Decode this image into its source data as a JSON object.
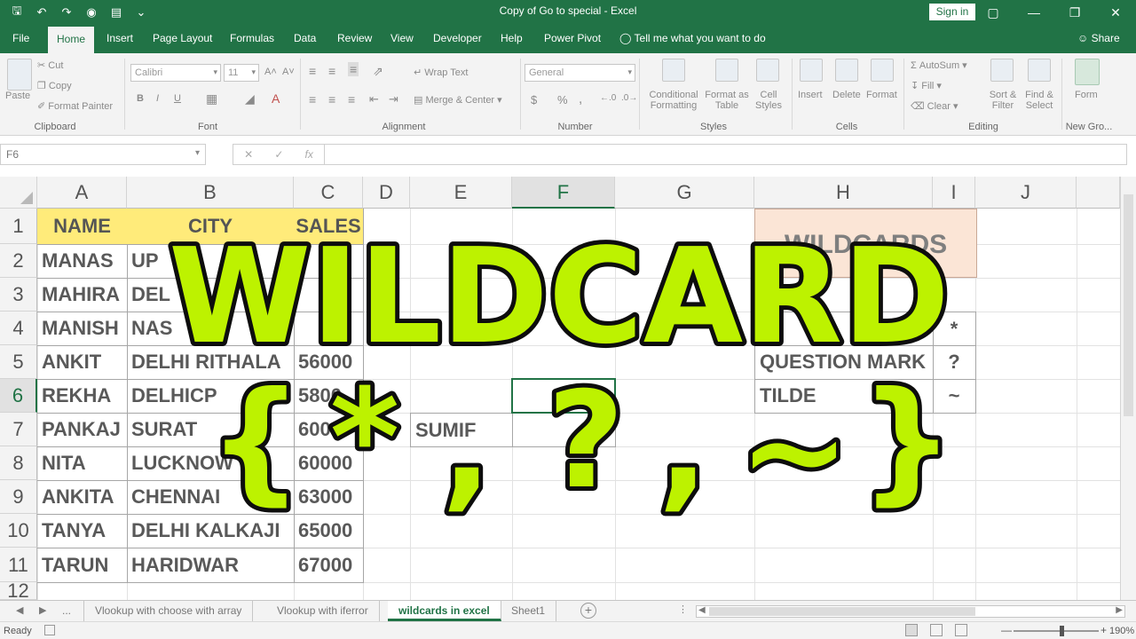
{
  "window": {
    "title": "Copy of Go to special - Excel",
    "sign_in": "Sign in"
  },
  "tabs": [
    {
      "label": "File"
    },
    {
      "label": "Home"
    },
    {
      "label": "Insert"
    },
    {
      "label": "Page Layout"
    },
    {
      "label": "Formulas"
    },
    {
      "label": "Data"
    },
    {
      "label": "Review"
    },
    {
      "label": "View"
    },
    {
      "label": "Developer"
    },
    {
      "label": "Help"
    },
    {
      "label": "Power Pivot"
    }
  ],
  "active_tab": "Home",
  "tell_me": "Tell me what you want to do",
  "share": "Share",
  "ribbon": {
    "clipboard": {
      "group": "Clipboard",
      "paste": "Paste",
      "cut": "Cut",
      "copy": "Copy",
      "format_painter": "Format Painter"
    },
    "font": {
      "group": "Font",
      "font_name": "Calibri",
      "font_size": "11",
      "bold": "B",
      "italic": "I",
      "underline": "U"
    },
    "alignment": {
      "group": "Alignment",
      "wrap_text": "Wrap Text",
      "merge_center": "Merge & Center"
    },
    "number": {
      "group": "Number",
      "format": "General",
      "currency": "$",
      "percent": "%",
      "comma": ","
    },
    "styles": {
      "group": "Styles",
      "conditional": "Conditional",
      "formatting": "Formatting",
      "format_as": "Format as",
      "table": "Table",
      "cell": "Cell",
      "cell_styles": "Styles"
    },
    "cells": {
      "group": "Cells",
      "insert": "Insert",
      "delete": "Delete",
      "format": "Format"
    },
    "editing": {
      "group": "Editing",
      "autosum": "AutoSum",
      "fill": "Fill",
      "clear": "Clear",
      "sort": "Sort &",
      "filter": "Filter",
      "find": "Find &",
      "select": "Select"
    },
    "new_group": {
      "group": "New Gro...",
      "form": "Form"
    }
  },
  "formula_bar": {
    "name_box": "F6",
    "fx": "fx",
    "formula": ""
  },
  "columns": [
    "A",
    "B",
    "C",
    "D",
    "E",
    "F",
    "G",
    "H",
    "I",
    "J"
  ],
  "rows": [
    "1",
    "2",
    "3",
    "4",
    "5",
    "6",
    "7",
    "8",
    "9",
    "10",
    "11",
    "12"
  ],
  "selected_cell": "F6",
  "table": {
    "headers": [
      "NAME",
      "CITY",
      "SALES"
    ],
    "rows": [
      [
        "MANAS",
        "UP",
        ""
      ],
      [
        "MAHIRA",
        "DEL",
        ""
      ],
      [
        "MANISH",
        "NAS",
        ""
      ],
      [
        "ANKIT",
        "DELHI RITHALA",
        "56000"
      ],
      [
        "REKHA",
        "DELHICP",
        "5800"
      ],
      [
        "PANKAJ",
        "SURAT",
        "600"
      ],
      [
        "NITA",
        "LUCKNOW",
        "60000"
      ],
      [
        "ANKITA",
        "CHENNAI",
        "63000"
      ],
      [
        "TANYA",
        "DELHI KALKAJI",
        "65000"
      ],
      [
        "TARUN",
        "HARIDWAR",
        "67000"
      ]
    ]
  },
  "sumif_label": "SUMIF",
  "wildcards": {
    "title": "WILDCARDS",
    "items": [
      {
        "name": "",
        "symbol": "*"
      },
      {
        "name": "QUESTION MARK",
        "symbol": "?"
      },
      {
        "name": "TILDE",
        "symbol": "~"
      }
    ]
  },
  "overlay": {
    "headline": "WILDCARD",
    "symbols": [
      "{",
      "*",
      ",",
      "?",
      ",",
      "~",
      "}"
    ]
  },
  "sheets": [
    {
      "label": "..."
    },
    {
      "label": "Vlookup with choose with array"
    },
    {
      "label": "Vlookup with iferror"
    },
    {
      "label": "wildcards in excel"
    },
    {
      "label": "Sheet1"
    }
  ],
  "active_sheet": "wildcards in excel",
  "status": {
    "ready": "Ready",
    "zoom": "190%"
  },
  "colors": {
    "excel_green": "#217346",
    "header_yellow": "#ffeb7a",
    "wildcard_box": "#fbe5d6",
    "overlay_fill": "#bdf200"
  }
}
